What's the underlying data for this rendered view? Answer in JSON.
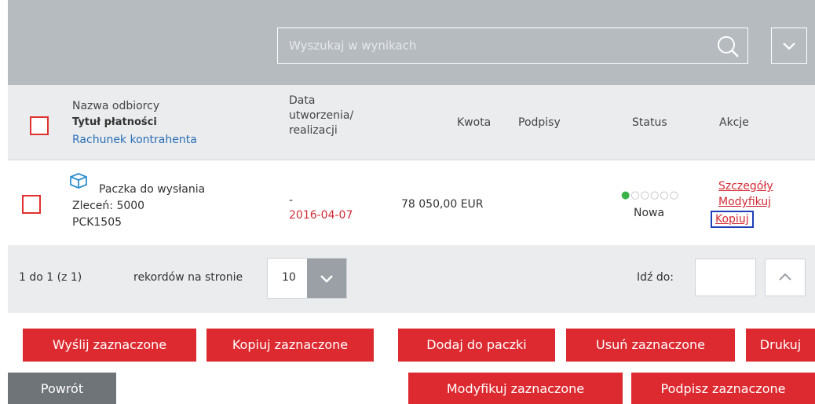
{
  "search": {
    "placeholder": "Wyszukaj w wynikach"
  },
  "header": {
    "recipient": "Nazwa odbiorcy",
    "payment_title": "Tytuł płatności",
    "counterparty_account": "Rachunek kontrahenta",
    "date_line1": "Data",
    "date_line2": "utworzenia/",
    "date_line3": "realizacji",
    "amount": "Kwota",
    "signatures": "Podpisy",
    "status": "Status",
    "actions": "Akcje"
  },
  "row": {
    "name": "Paczka do wysłania",
    "orders": "Zleceń: 5000",
    "code": "PCK1505",
    "date_created": "-",
    "date_exec": "2016-04-07",
    "amount": "78 050,00 EUR",
    "status_dots": "●○○○○○",
    "status": "Nowa",
    "action_details": "Szczegóły",
    "action_modify": "Modyfikuj",
    "action_copy": "Kopiuj"
  },
  "pager": {
    "range": "1 do 1 (z 1)",
    "per_page_label": "rekordów na stronie",
    "per_page_value": "10",
    "goto_label": "Idź do:"
  },
  "buttons": {
    "send_selected": "Wyślij zaznaczone",
    "copy_selected": "Kopiuj zaznaczone",
    "add_to_package": "Dodaj do paczki",
    "delete_selected": "Usuń zaznaczone",
    "print": "Drukuj",
    "back": "Powrót",
    "modify_selected": "Modyfikuj zaznaczone",
    "sign_selected": "Podpisz zaznaczone"
  },
  "colors": {
    "accent": "#dd2a30",
    "link_blue": "#2a6fb5",
    "topbar": "#b6bbc0",
    "highlight": "#1f3fb8"
  },
  "icons": [
    "search-icon",
    "chevron-down-icon",
    "package-icon",
    "chevron-up-icon"
  ]
}
